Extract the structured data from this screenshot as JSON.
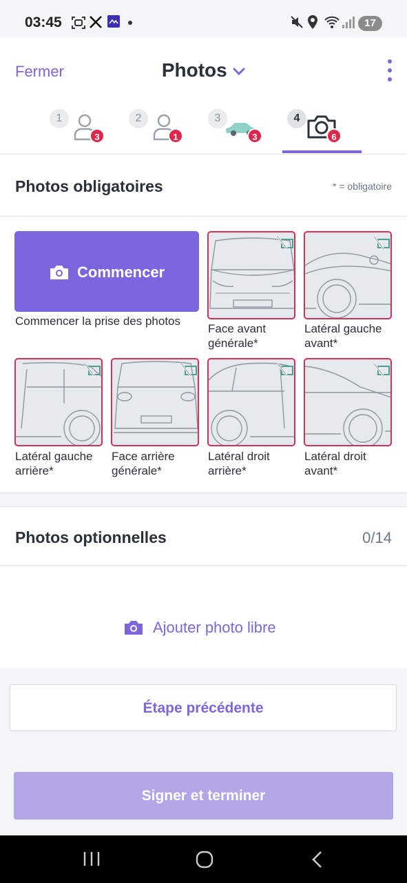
{
  "status_bar": {
    "time": "03:45",
    "battery": "17",
    "icons": [
      "screenshot-icon",
      "x-logo-icon",
      "app-icon",
      "dot-icon",
      "mute-icon",
      "location-icon",
      "wifi-icon",
      "signal-icon",
      "battery-icon"
    ]
  },
  "header": {
    "close_label": "Fermer",
    "title": "Photos",
    "menu_icon": "kebab-icon"
  },
  "steps": [
    {
      "number": "1",
      "icon": "person-icon",
      "badge": "3",
      "active": false
    },
    {
      "number": "2",
      "icon": "person-icon",
      "badge": "1",
      "active": false
    },
    {
      "number": "3",
      "icon": "car-icon",
      "badge": "3",
      "active": false
    },
    {
      "number": "4",
      "icon": "camera-icon",
      "badge": "6",
      "active": true
    }
  ],
  "mandatory": {
    "title": "Photos obligatoires",
    "required_note": "* = obligatoire",
    "start_button": "Commencer",
    "start_caption": "Commencer la prise des photos",
    "tiles": [
      {
        "label_line1": "Face avant",
        "label_line2": "générale*",
        "view": "front"
      },
      {
        "label_line1": "Latéral gauche",
        "label_line2": "avant*",
        "view": "left-front"
      },
      {
        "label_line1": "Latéral gauche",
        "label_line2": "arrière*",
        "view": "left-rear"
      },
      {
        "label_line1": "Face arrière",
        "label_line2": "générale*",
        "view": "rear"
      },
      {
        "label_line1": "Latéral droit",
        "label_line2": "arrière*",
        "view": "right-rear"
      },
      {
        "label_line1": "Latéral droit",
        "label_line2": "avant*",
        "view": "right-front"
      }
    ]
  },
  "optional": {
    "title": "Photos optionnelles",
    "count": "0/14",
    "add_label": "Ajouter photo libre"
  },
  "footer": {
    "prev_label": "Étape précédente",
    "sign_label": "Signer et terminer"
  },
  "colors": {
    "accent": "#7c66d9",
    "badge": "#e1264b",
    "tile_border": "#d3305a",
    "disabled_button": "#b3a6e6"
  }
}
